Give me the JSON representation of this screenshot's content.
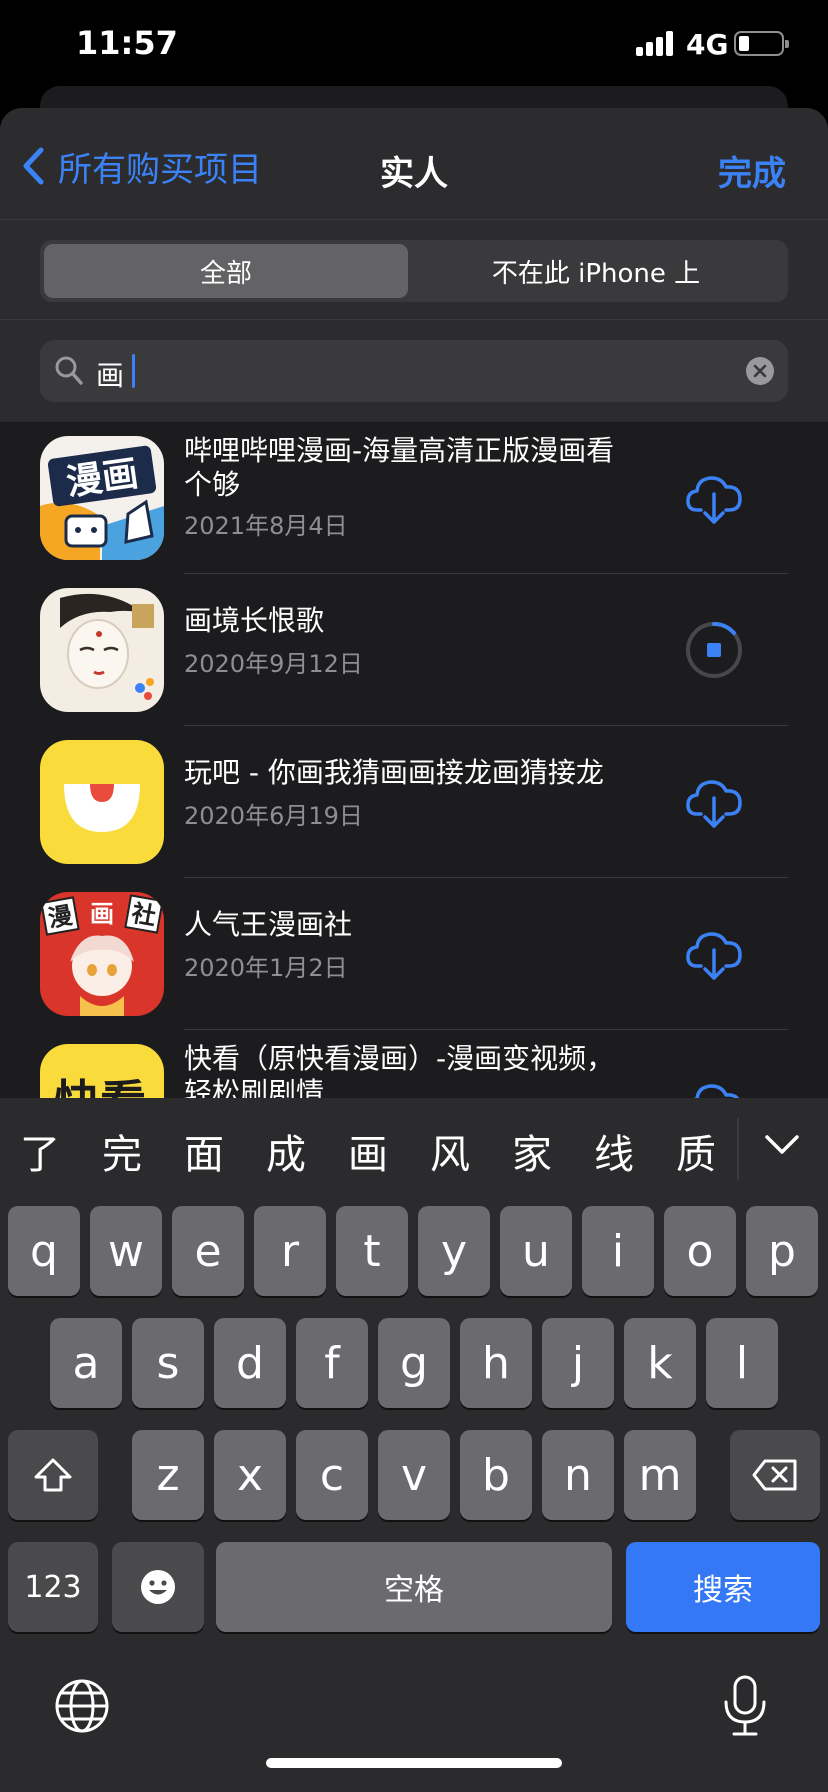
{
  "status_bar": {
    "time": "11:57",
    "network": "4G"
  },
  "nav": {
    "back_label": "所有购买项目",
    "title": "实人",
    "done_label": "完成"
  },
  "segments": {
    "all_label": "全部",
    "not_on_device_label": "不在此 iPhone 上"
  },
  "search": {
    "query": "画"
  },
  "apps": [
    {
      "name": "哔哩哔哩漫画-海量高清正版漫画看个够",
      "date": "2021年8月4日",
      "status": "download",
      "icon": "bilibili-comics-icon"
    },
    {
      "name": "画境长恨歌",
      "date": "2020年9月12日",
      "status": "downloading",
      "icon": "changhenge-icon"
    },
    {
      "name": "玩吧 - 你画我猜画画接龙画猜接龙",
      "date": "2020年6月19日",
      "status": "download",
      "icon": "wanba-icon"
    },
    {
      "name": "人气王漫画社",
      "date": "2020年1月2日",
      "status": "download",
      "icon": "manhuashe-icon"
    },
    {
      "name": "快看（原快看漫画）-漫画变视频，轻松刷剧情",
      "date": "",
      "status": "download",
      "icon": "kuaikan-icon"
    }
  ],
  "keyboard": {
    "candidates": [
      "了",
      "完",
      "面",
      "成",
      "画",
      "风",
      "家",
      "线",
      "质"
    ],
    "row1": [
      "q",
      "w",
      "e",
      "r",
      "t",
      "y",
      "u",
      "i",
      "o",
      "p"
    ],
    "row2": [
      "a",
      "s",
      "d",
      "f",
      "g",
      "h",
      "j",
      "k",
      "l"
    ],
    "row3": [
      "z",
      "x",
      "c",
      "v",
      "b",
      "n",
      "m"
    ],
    "numbers_label": "123",
    "space_label": "空格",
    "search_label": "搜索"
  },
  "colors": {
    "accent": "#3b82f6",
    "sheet_bg": "#1c1c1e",
    "secondary_text": "#8e8e93"
  }
}
